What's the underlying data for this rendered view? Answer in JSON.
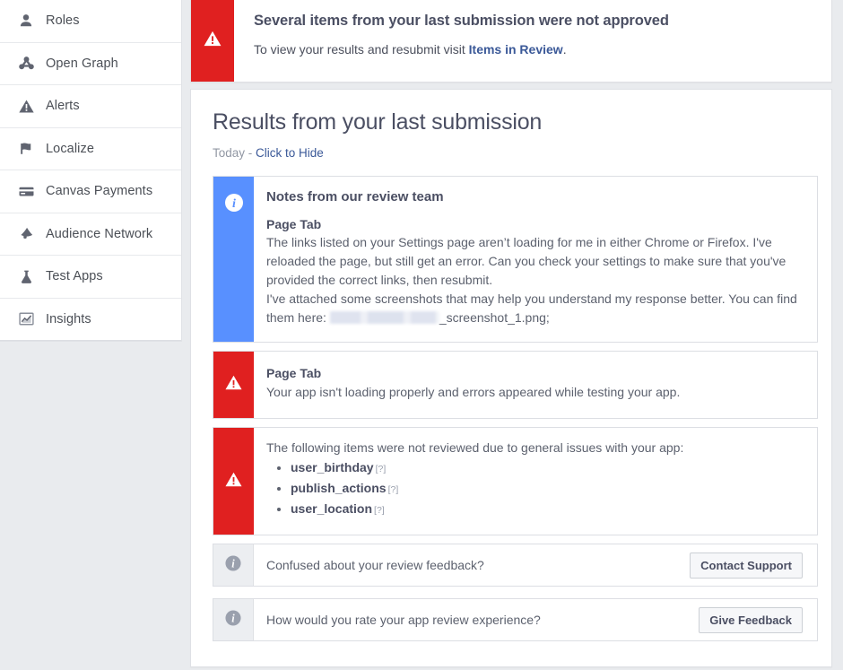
{
  "colors": {
    "page_bg": "#e9ebee",
    "panel_bg": "#ffffff",
    "danger_red": "#e02020",
    "info_blue": "#5890ff",
    "link_blue": "#3b5998",
    "stripe_gray": "#eceef1",
    "text_dark": "#4b4f63",
    "text_body": "#5c616e",
    "muted": "#9197a3"
  },
  "sidebar": {
    "items": [
      {
        "label": "Roles",
        "icon": "person-icon"
      },
      {
        "label": "Open Graph",
        "icon": "open-graph-icon"
      },
      {
        "label": "Alerts",
        "icon": "warning-triangle-icon"
      },
      {
        "label": "Localize",
        "icon": "flag-icon"
      },
      {
        "label": "Canvas Payments",
        "icon": "credit-card-icon"
      },
      {
        "label": "Audience Network",
        "icon": "megaphone-icon"
      },
      {
        "label": "Test Apps",
        "icon": "flask-icon"
      },
      {
        "label": "Insights",
        "icon": "chart-icon"
      }
    ]
  },
  "alert_banner": {
    "icon": "warning-triangle-icon",
    "title": "Several items from your last submission were not approved",
    "body_prefix": "To view your results and resubmit visit ",
    "link_label": "Items in Review",
    "body_suffix": "."
  },
  "results_panel": {
    "title": "Results from your last submission",
    "meta_date": "Today",
    "meta_separator": " - ",
    "meta_toggle_label": "Click to Hide"
  },
  "notes_card": {
    "icon": "info-circle-icon",
    "heading": "Notes from our review team",
    "subheading": "Page Tab",
    "paragraph_1": "The links listed on your Settings page aren’t loading for me in either Chrome or Firefox. I've reloaded the page, but still get an error. Can you check your settings to make sure that you've provided the correct links, then resubmit.",
    "paragraph_2_prefix": "I've attached some screenshots that may help you understand my response better. You can find them here: ",
    "redacted_label": "redacted-path",
    "paragraph_2_suffix": "_screenshot_1.png;"
  },
  "pagetab_card": {
    "icon": "warning-triangle-icon",
    "subheading": "Page Tab",
    "text": "Your app isn't loading properly and errors appeared while testing your app."
  },
  "not_reviewed_card": {
    "icon": "warning-triangle-icon",
    "intro": "The following items were not reviewed due to general issues with your app:",
    "items": [
      {
        "name": "user_birthday",
        "help": "[?]"
      },
      {
        "name": "publish_actions",
        "help": "[?]"
      },
      {
        "name": "user_location",
        "help": "[?]"
      }
    ]
  },
  "action_rows": [
    {
      "icon": "info-circle-icon",
      "text": "Confused about your review feedback?",
      "button_label": "Contact Support"
    },
    {
      "icon": "info-circle-icon",
      "text": "How would you rate your app review experience?",
      "button_label": "Give Feedback"
    }
  ]
}
